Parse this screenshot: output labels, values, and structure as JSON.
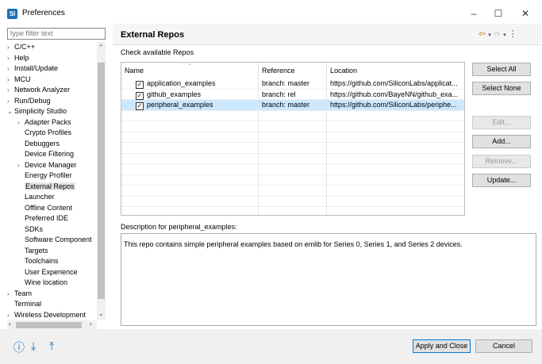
{
  "window": {
    "title": "Preferences",
    "minimize": "–",
    "maximize": "☐",
    "close": "✕",
    "icon": "SI"
  },
  "filter": {
    "placeholder": "type filter text"
  },
  "tree": [
    {
      "label": "C/C++",
      "arrow": "›",
      "indent": 0
    },
    {
      "label": "Help",
      "arrow": "›",
      "indent": 0
    },
    {
      "label": "Install/Update",
      "arrow": "›",
      "indent": 0
    },
    {
      "label": "MCU",
      "arrow": "›",
      "indent": 0
    },
    {
      "label": "Network Analyzer",
      "arrow": "›",
      "indent": 0
    },
    {
      "label": "Run/Debug",
      "arrow": "›",
      "indent": 0
    },
    {
      "label": "Simplicity Studio",
      "arrow": "⌄",
      "indent": 0
    },
    {
      "label": "Adapter Packs",
      "arrow": "›",
      "indent": 1
    },
    {
      "label": "Crypto Profiles",
      "arrow": "",
      "indent": 1
    },
    {
      "label": "Debuggers",
      "arrow": "",
      "indent": 1
    },
    {
      "label": "Device Filtering",
      "arrow": "",
      "indent": 1
    },
    {
      "label": "Device Manager",
      "arrow": "›",
      "indent": 1
    },
    {
      "label": "Energy Profiler",
      "arrow": "",
      "indent": 1
    },
    {
      "label": "External Repos",
      "arrow": "",
      "indent": 1,
      "selected": true
    },
    {
      "label": "Launcher",
      "arrow": "",
      "indent": 1
    },
    {
      "label": "Offline Content",
      "arrow": "",
      "indent": 1
    },
    {
      "label": "Preferred IDE",
      "arrow": "",
      "indent": 1
    },
    {
      "label": "SDKs",
      "arrow": "",
      "indent": 1
    },
    {
      "label": "Software Component",
      "arrow": "",
      "indent": 1
    },
    {
      "label": "Targets",
      "arrow": "",
      "indent": 1
    },
    {
      "label": "Toolchains",
      "arrow": "",
      "indent": 1
    },
    {
      "label": "User Experience",
      "arrow": "",
      "indent": 1
    },
    {
      "label": "Wine location",
      "arrow": "",
      "indent": 1
    },
    {
      "label": "Team",
      "arrow": "›",
      "indent": 0
    },
    {
      "label": "Terminal",
      "arrow": "",
      "indent": 0
    },
    {
      "label": "Wireless Development",
      "arrow": "›",
      "indent": 0
    }
  ],
  "panel": {
    "title": "External Repos",
    "check_label": "Check available Repos",
    "columns": {
      "name": "Name",
      "reference": "Reference",
      "location": "Location"
    },
    "rows": [
      {
        "name": "application_examples",
        "reference": "branch: master",
        "location": "https://github.com/SiliconLabs/applicat...",
        "checked": true
      },
      {
        "name": "github_examples",
        "reference": "branch: rel",
        "location": "https://github.com/BayeNN/github_exa...",
        "checked": true
      },
      {
        "name": "peripheral_examples",
        "reference": "branch: master",
        "location": "https://github.com/SiliconLabs/periphe...",
        "checked": true,
        "selected": true
      }
    ],
    "buttons": {
      "select_all": "Select All",
      "select_none": "Select None",
      "edit": "Edit...",
      "add": "Add...",
      "remove": "Remove...",
      "update": "Update..."
    },
    "description_label": "Description for peripheral_examples:",
    "description": "This repo contains simple peripheral examples based on emlib for Series 0, Series 1, and Series 2 devices."
  },
  "footer": {
    "apply_close": "Apply and Close",
    "cancel": "Cancel"
  },
  "colors": {
    "accent": "#0078d7",
    "selection": "#cce8ff"
  }
}
